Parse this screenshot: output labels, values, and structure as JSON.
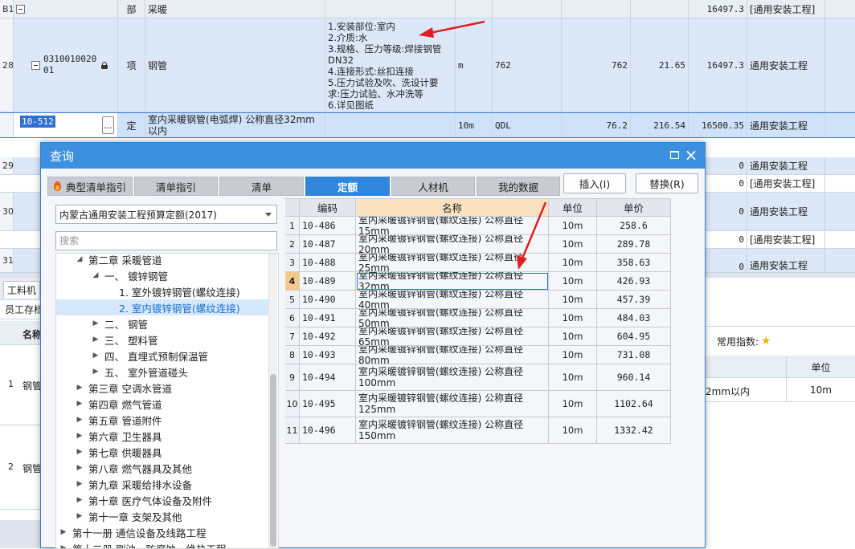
{
  "bg": {
    "row_b1": {
      "rownum": "B1",
      "type": "部",
      "name": "采暖",
      "total": "16497.3",
      "cat": "[通用安装工程]"
    },
    "row_28": {
      "rownum": "28",
      "code": [
        "0310010020",
        "01"
      ],
      "type": "项",
      "name": "钢管",
      "desc": [
        "1.安装部位:室内",
        "2.介质:水",
        "3.规格、压力等级:焊接钢管",
        "DN32",
        "4.连接形式:丝扣连接",
        "5.压力试验及吹、洗设计要",
        "求:压力试验、水冲洗等",
        "6.详见图纸"
      ],
      "unit": "m",
      "expr": "762",
      "qty": "762",
      "price": "21.65",
      "total": "16497.3",
      "cat": "通用安装工程"
    },
    "row_sel": {
      "code": "10-512",
      "type": "定",
      "name": "室内采暖钢管(电弧焊) 公称直径32mm以内",
      "unit": "10m",
      "expr": "QDL",
      "qty": "76.2",
      "price": "216.54",
      "total": "16500.35",
      "cat": "通用安装工程"
    },
    "row_29": {
      "rownum": "29",
      "total": "0",
      "cat": "通用安装工程"
    },
    "row_29b": {
      "total": "0",
      "cat": "[通用安装工程]"
    },
    "row_30": {
      "rownum": "30",
      "total": "0",
      "cat": "通用安装工程"
    },
    "row_30b": {
      "total": "0",
      "cat": "[通用安装工程]"
    },
    "row_31": {
      "rownum": "31",
      "total": "0",
      "cat": "通用安装工程"
    },
    "bottom_tab": "工料机",
    "bottom_sub": "员工存档",
    "bottom_head": "名称",
    "bottom_rows": [
      {
        "num": "1",
        "name": "钢管"
      },
      {
        "num": "2",
        "name": "钢管"
      }
    ],
    "right_panel": {
      "label": "常用指数:",
      "unit_head": "单位",
      "row_text": "2mm以内",
      "row_unit": "10m"
    }
  },
  "dialog": {
    "title": "查询",
    "tabs": [
      "典型清单指引",
      "清单指引",
      "清单",
      "定额",
      "人材机",
      "我的数据"
    ],
    "active_tab": "定额",
    "insert_button": "插入(I)",
    "replace_button": "替换(R)",
    "quota_library": "内蒙古通用安装工程预算定额(2017)",
    "search_placeholder": "搜索",
    "tree": [
      {
        "label": "第二章 采暖管道",
        "level": 1,
        "expanded": true,
        "selected": false
      },
      {
        "label": "一、 镀锌钢管",
        "level": 2,
        "expanded": true,
        "selected": false
      },
      {
        "label": "1. 室外镀锌钢管(螺纹连接)",
        "level": 3,
        "leaf": true,
        "selected": false
      },
      {
        "label": "2. 室内镀锌钢管(螺纹连接)",
        "level": 3,
        "leaf": true,
        "selected": true
      },
      {
        "label": "二、 钢管",
        "level": 2,
        "expanded": false,
        "selected": false
      },
      {
        "label": "三、 塑料管",
        "level": 2,
        "expanded": false,
        "selected": false
      },
      {
        "label": "四、 直埋式预制保温管",
        "level": 2,
        "expanded": false,
        "selected": false
      },
      {
        "label": "五、 室外管道碰头",
        "level": 2,
        "expanded": false,
        "selected": false
      },
      {
        "label": "第三章 空调水管道",
        "level": 1,
        "expanded": false,
        "selected": false
      },
      {
        "label": "第四章 燃气管道",
        "level": 1,
        "expanded": false,
        "selected": false
      },
      {
        "label": "第五章 管道附件",
        "level": 1,
        "expanded": false,
        "selected": false
      },
      {
        "label": "第六章 卫生器具",
        "level": 1,
        "expanded": false,
        "selected": false
      },
      {
        "label": "第七章 供暖器具",
        "level": 1,
        "expanded": false,
        "selected": false
      },
      {
        "label": "第八章 燃气器具及其他",
        "level": 1,
        "expanded": false,
        "selected": false
      },
      {
        "label": "第九章 采暖给排水设备",
        "level": 1,
        "expanded": false,
        "selected": false
      },
      {
        "label": "第十章 医疗气体设备及附件",
        "level": 1,
        "expanded": false,
        "selected": false
      },
      {
        "label": "第十一章 支架及其他",
        "level": 1,
        "expanded": false,
        "selected": false
      },
      {
        "label": "第十一册 通信设备及线路工程",
        "level": 0,
        "expanded": false,
        "selected": false
      },
      {
        "label": "第十二册 刷油、防腐蚀、绝热工程",
        "level": 0,
        "expanded": false,
        "selected": false
      }
    ],
    "columns": {
      "code": "编码",
      "name": "名称",
      "unit": "单位",
      "price": "单价"
    },
    "rows": [
      {
        "idx": "1",
        "code": "10-486",
        "name": "室内采暖镀锌钢管(螺纹连接) 公称直径15mm",
        "unit": "10m",
        "price": "258.6"
      },
      {
        "idx": "2",
        "code": "10-487",
        "name": "室内采暖镀锌钢管(螺纹连接) 公称直径20mm",
        "unit": "10m",
        "price": "289.78"
      },
      {
        "idx": "3",
        "code": "10-488",
        "name": "室内采暖镀锌钢管(螺纹连接) 公称直径25mm",
        "unit": "10m",
        "price": "358.63"
      },
      {
        "idx": "4",
        "code": "10-489",
        "name": "室内采暖镀锌钢管(螺纹连接) 公称直径32mm",
        "unit": "10m",
        "price": "426.93"
      },
      {
        "idx": "5",
        "code": "10-490",
        "name": "室内采暖镀锌钢管(螺纹连接) 公称直径40mm",
        "unit": "10m",
        "price": "457.39"
      },
      {
        "idx": "6",
        "code": "10-491",
        "name": "室内采暖镀锌钢管(螺纹连接) 公称直径50mm",
        "unit": "10m",
        "price": "484.03"
      },
      {
        "idx": "7",
        "code": "10-492",
        "name": "室内采暖镀锌钢管(螺纹连接) 公称直径65mm",
        "unit": "10m",
        "price": "604.95"
      },
      {
        "idx": "8",
        "code": "10-493",
        "name": "室内采暖镀锌钢管(螺纹连接) 公称直径80mm",
        "unit": "10m",
        "price": "731.08"
      },
      {
        "idx": "9",
        "code": "10-494",
        "name": "室内采暖镀锌钢管(螺纹连接) 公称直径100mm",
        "unit": "10m",
        "price": "960.14"
      },
      {
        "idx": "10",
        "code": "10-495",
        "name": "室内采暖镀锌钢管(螺纹连接) 公称直径125mm",
        "unit": "10m",
        "price": "1102.64"
      },
      {
        "idx": "11",
        "code": "10-496",
        "name": "室内采暖镀锌钢管(螺纹连接) 公称直径150mm",
        "unit": "10m",
        "price": "1332.42"
      }
    ],
    "current_row": "4"
  },
  "colors": {
    "accent": "#3d8fe0",
    "annotation_arrow": "#e02020",
    "selected_row": "#cfe2f8"
  }
}
